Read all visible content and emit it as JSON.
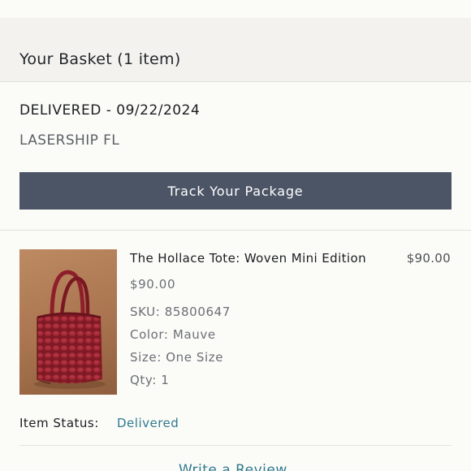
{
  "basket": {
    "title": "Your Basket (1 item)"
  },
  "delivery": {
    "status": "DELIVERED - 09/22/2024",
    "carrier": "LASERSHIP FL",
    "track_button_label": "Track Your Package"
  },
  "item": {
    "name": "The Hollace Tote: Woven Mini Edition",
    "line_total": "$90.00",
    "unit_price": "$90.00",
    "sku": "SKU: 85800647",
    "color": "Color: Mauve",
    "size": "Size: One Size",
    "qty": "Qty: 1",
    "status_label": "Item Status:",
    "status_value": "Delivered",
    "review_link": "Write a Review",
    "image_colors": {
      "background": "#a9744f",
      "bag": "#8e1f2a"
    }
  },
  "theme": {
    "button_bg": "#4c5566",
    "link_color": "#2f7a91",
    "header_bg": "#f3f2ee"
  }
}
